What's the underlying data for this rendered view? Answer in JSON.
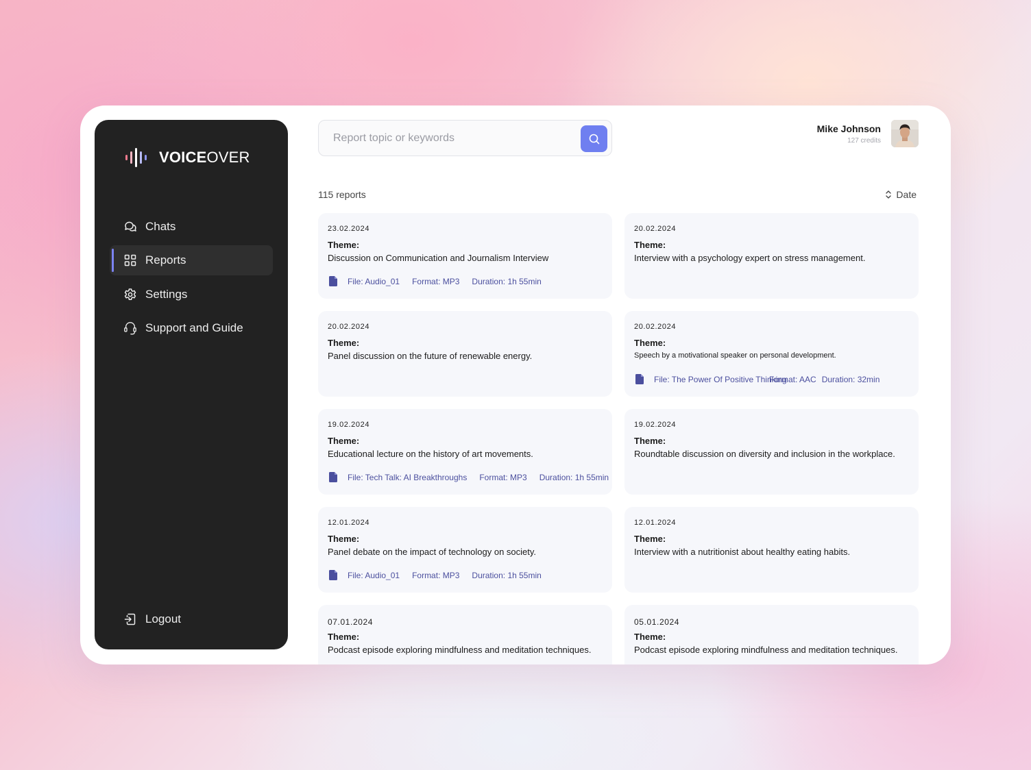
{
  "brand": {
    "name_bold": "VOICE",
    "name_light": "OVER"
  },
  "nav": {
    "items": [
      {
        "label": "Chats",
        "icon": "chat-bubbles-icon"
      },
      {
        "label": "Reports",
        "icon": "grid-icon",
        "active": true
      },
      {
        "label": "Settings",
        "icon": "gear-icon"
      },
      {
        "label": "Support and Guide",
        "icon": "headset-icon"
      }
    ],
    "logout": "Logout"
  },
  "search": {
    "placeholder": "Report topic or keywords"
  },
  "user": {
    "name": "Mike Johnson",
    "credits": "127 credits"
  },
  "list": {
    "count": "115  reports",
    "sort_label": "Date"
  },
  "accent": "#6f7ff0",
  "reports": [
    {
      "date": "23.02.2024",
      "theme_label": "Theme:",
      "theme": "Discussion on Communication and Journalism Interview",
      "file": "File: Audio_01",
      "format": "Format: MP3",
      "duration": "Duration: 1h 55min"
    },
    {
      "date": "20.02.2024",
      "theme_label": "Theme:",
      "theme": "Interview with a psychology expert on stress management."
    },
    {
      "date": "20.02.2024",
      "theme_label": "Theme:",
      "theme": "Panel discussion on the future of renewable energy."
    },
    {
      "date": "20.02.2024",
      "theme_label": "Theme:",
      "theme": "Speech by a motivational speaker on personal development.",
      "file": "File: The Power Of Positive Thinking",
      "format": "Format: AAC",
      "duration": "Duration: 32min"
    },
    {
      "date": "19.02.2024",
      "theme_label": "Theme:",
      "theme": "Educational lecture on the history of art movements.",
      "file": "File: Tech Talk: AI Breakthroughs",
      "format": "Format: MP3",
      "duration": "Duration: 1h 55min"
    },
    {
      "date": "19.02.2024",
      "theme_label": "Theme:",
      "theme": "Roundtable discussion on diversity and inclusion in the workplace."
    },
    {
      "date": "12.01.2024",
      "theme_label": "Theme:",
      "theme": "Panel debate on the impact of technology on society.",
      "file": "File: Audio_01",
      "format": "Format: MP3",
      "duration": "Duration: 1h 55min"
    },
    {
      "date": "12.01.2024",
      "theme_label": "Theme:",
      "theme": "Interview with a nutritionist about healthy eating habits."
    },
    {
      "date": "07.01.2024",
      "theme_label": "Theme:",
      "theme": "Podcast episode exploring mindfulness and meditation techniques."
    },
    {
      "date": "05.01.2024",
      "theme_label": "Theme:",
      "theme": "Podcast episode exploring mindfulness and meditation techniques."
    }
  ]
}
